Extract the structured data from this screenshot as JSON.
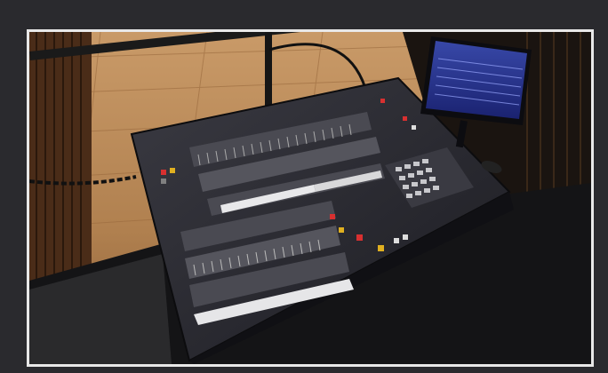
{
  "image": {
    "kind": "photograph",
    "subject": "lighting-console-on-stage-balcony",
    "icons": [
      "lighting-console",
      "monitor",
      "railing-chain"
    ],
    "colors": {
      "page_background": "#2a2a2e",
      "photo_border": "#e8e8e8",
      "stage_floor": "#b8865a",
      "console_body": "#2a2a30",
      "monitor_screen": "#2b3a8a"
    }
  }
}
